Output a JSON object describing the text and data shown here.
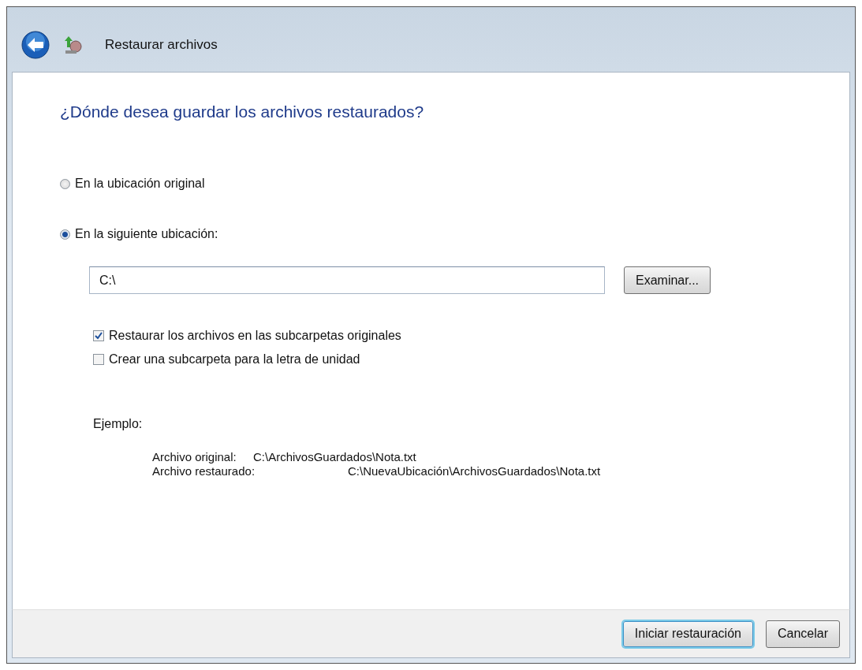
{
  "window": {
    "title": "Restaurar archivos"
  },
  "heading": "¿Dónde desea guardar los archivos restaurados?",
  "location_options": [
    {
      "label": "En la ubicación original",
      "selected": false
    },
    {
      "label": "En la siguiente ubicación:",
      "selected": true
    }
  ],
  "path_field": {
    "value": "C:\\"
  },
  "browse_button": "Examinar...",
  "options": [
    {
      "label": "Restaurar los archivos en las subcarpetas originales",
      "checked": true
    },
    {
      "label": "Crear una subcarpeta para la letra de unidad",
      "checked": false
    }
  ],
  "example": {
    "title": "Ejemplo:",
    "lines": [
      {
        "label": "Archivo original:",
        "value": "C:\\ArchivosGuardados\\Nota.txt"
      },
      {
        "label": "Archivo restaurado:",
        "value": "C:\\NuevaUbicación\\ArchivosGuardados\\Nota.txt"
      }
    ]
  },
  "buttons": [
    {
      "label": "Iniciar restauración",
      "default": true
    },
    {
      "label": "Cancelar",
      "default": false
    }
  ]
}
